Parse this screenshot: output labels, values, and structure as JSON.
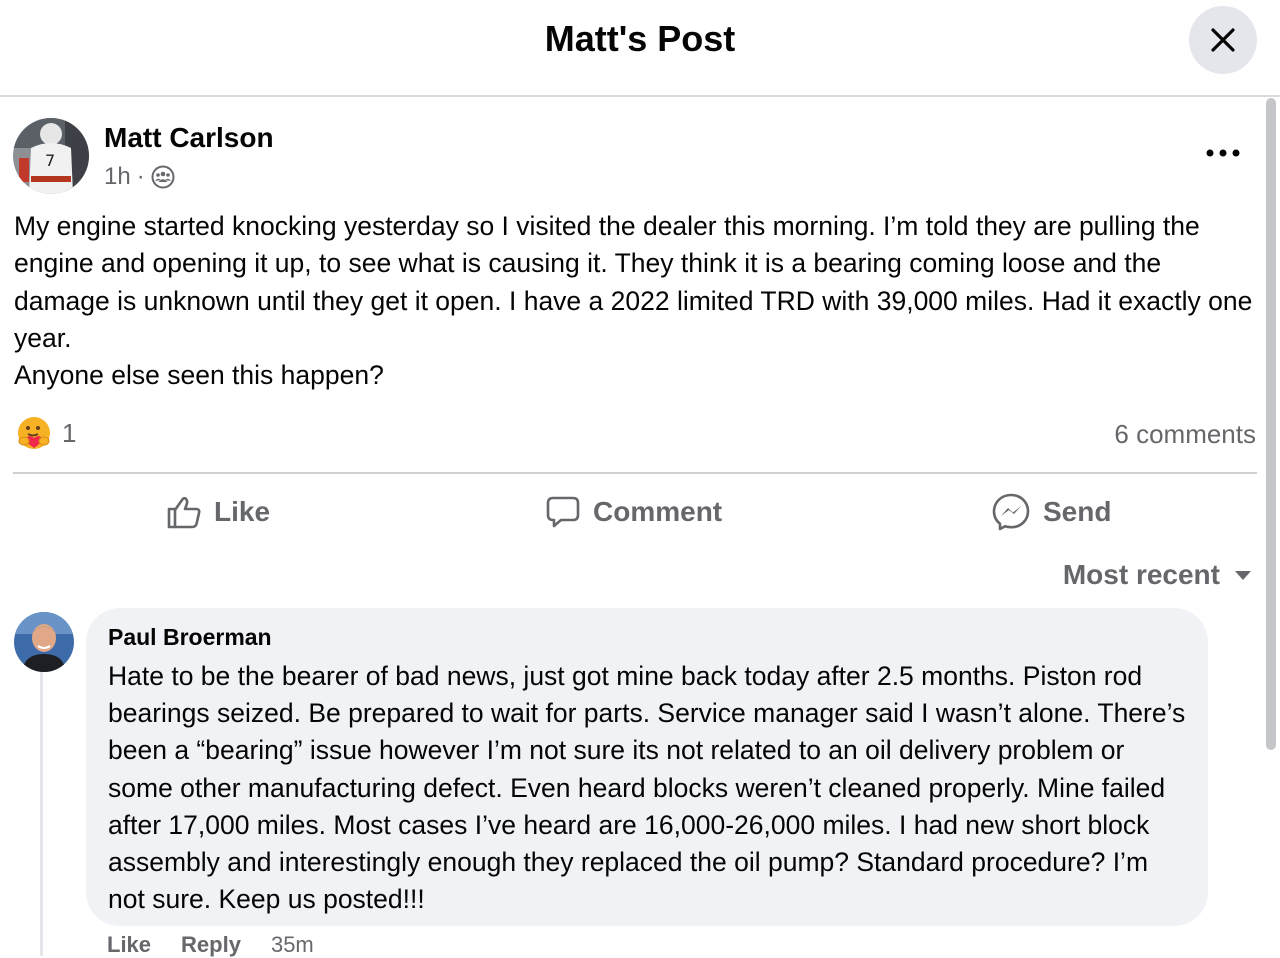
{
  "header": {
    "title": "Matt's Post",
    "close_icon": "close-icon"
  },
  "post": {
    "author": "Matt Carlson",
    "time": "1h",
    "separator": "·",
    "audience_icon": "group-icon",
    "body_paragraphs": [
      "My engine started knocking yesterday so I visited the dealer this morning. I’m told they are pulling the engine and opening it up, to see what is causing it. They think it is a bearing coming loose and the damage is unknown until they get it open. I have a 2022 limited TRD with 39,000 miles. Had it exactly one year.",
      "Anyone else seen this happen?"
    ],
    "reaction_icon": "care-reaction-icon",
    "reaction_count": "1",
    "comment_count": "6 comments"
  },
  "actions": {
    "like": "Like",
    "comment": "Comment",
    "send": "Send"
  },
  "sort": {
    "label": "Most recent"
  },
  "comment": {
    "author": "Paul Broerman",
    "text": "Hate to be the bearer of bad news, just got mine back today after 2.5 months. Piston rod bearings seized. Be prepared to wait for parts. Service manager said I wasn’t alone. There’s been a “bearing” issue however I’m not sure its not related to an oil delivery problem or some other manufacturing defect. Even heard blocks weren’t cleaned properly. Mine failed after 17,000 miles. Most cases I’ve heard are 16,000-26,000 miles. I had new short block assembly and interestingly enough they replaced the oil pump? Standard procedure? I’m not sure. Keep us posted!!!",
    "like": "Like",
    "reply": "Reply",
    "time": "35m"
  },
  "colors": {
    "text": "#050505",
    "secondary": "#65676b",
    "bubble": "#f0f2f5",
    "divider": "#ced0d4"
  }
}
